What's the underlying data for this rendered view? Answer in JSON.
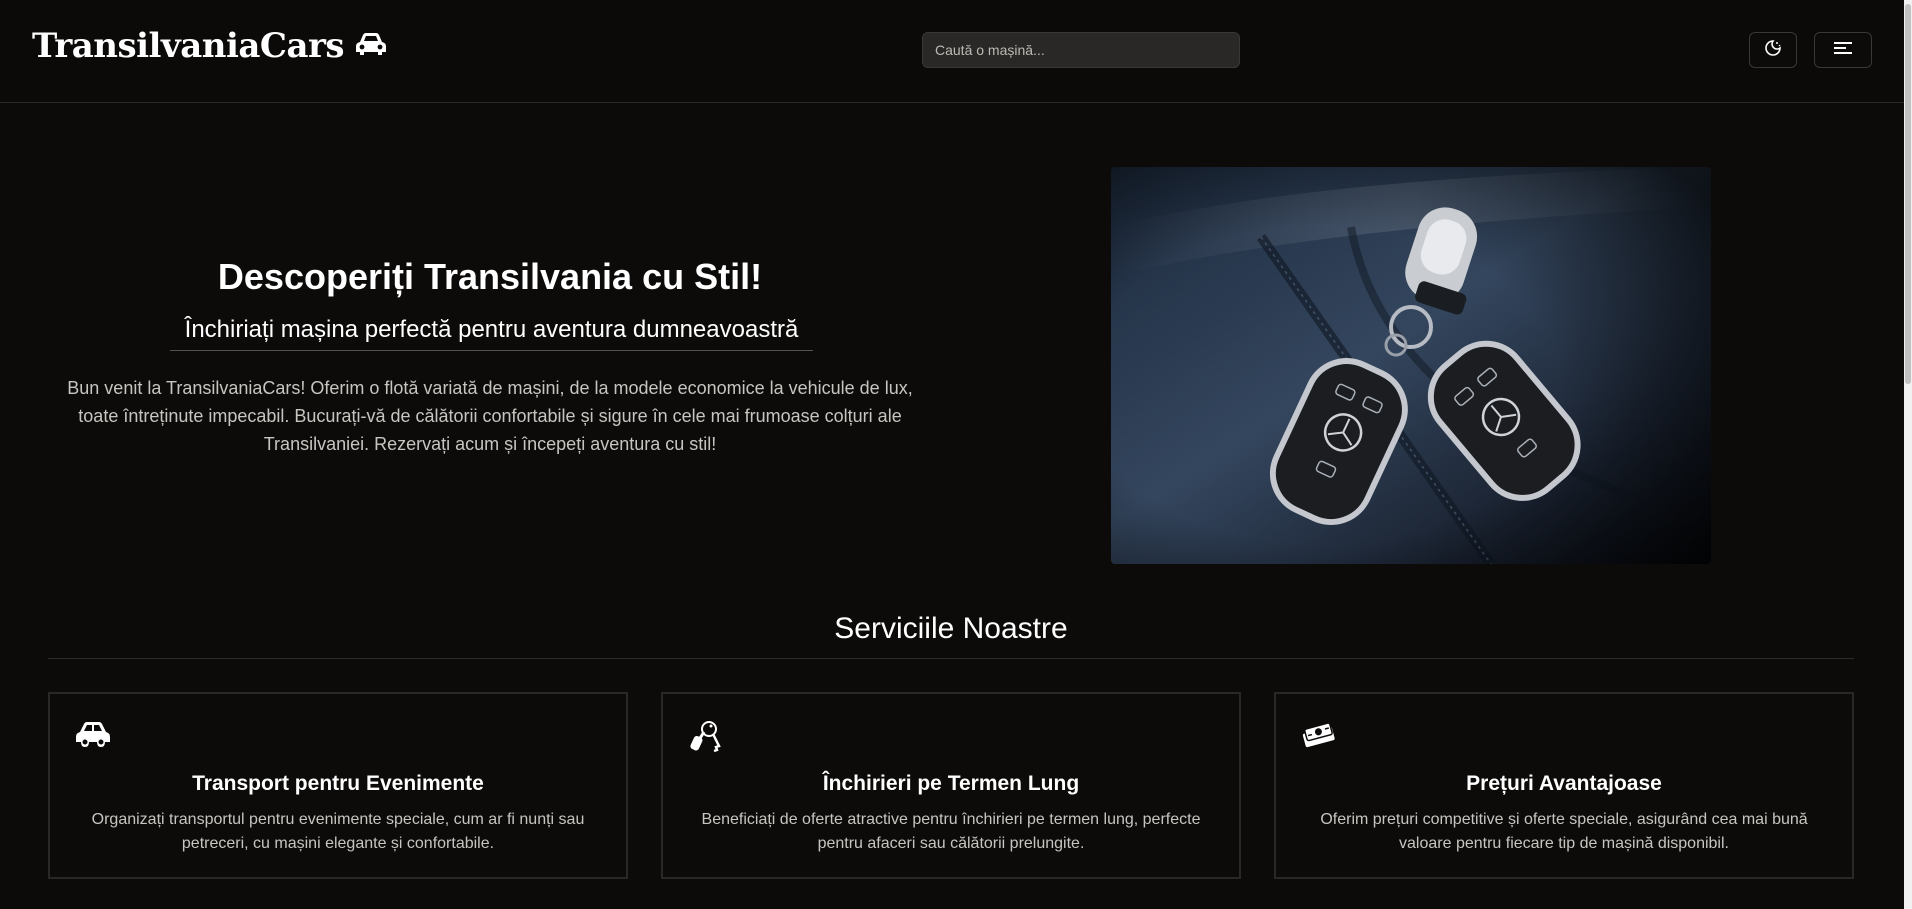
{
  "header": {
    "logo_text": "TransilvaniaCars",
    "logo_icon": "car-icon",
    "search_placeholder": "Caută o mașină...",
    "theme_toggle_icon": "moon-sun-icon",
    "menu_icon": "hamburger-icon"
  },
  "hero": {
    "title": "Descoperiți Transilvania cu Stil!",
    "subtitle": "Închiriați mașina perfectă pentru aventura dumneavoastră",
    "description": "Bun venit la TransilvaniaCars! Oferim o flotă variată de mașini, de la modele economice la vehicule de lux, toate întreținute impecabil. Bucurați-vă de călătorii confortabile și sigure în cele mai frumoase colțuri ale Transilvaniei. Rezervați acum și începeți aventura cu stil!",
    "image": "car-keys-photo"
  },
  "services": {
    "title": "Serviciile Noastre",
    "items": [
      {
        "icon": "car-icon",
        "title": "Transport pentru Evenimente",
        "description": "Organizați transportul pentru evenimente speciale, cum ar fi nunți sau petreceri, cu mașini elegante și confortabile."
      },
      {
        "icon": "keys-icon",
        "title": "Închirieri pe Termen Lung",
        "description": "Beneficiați de oferte atractive pentru închirieri pe termen lung, perfecte pentru afaceri sau călătorii prelungite."
      },
      {
        "icon": "money-icon",
        "title": "Prețuri Avantajoase",
        "description": "Oferim prețuri competitive și oferte speciale, asigurând cea mai bună valoare pentru fiecare tip de mașină disponibil."
      }
    ]
  },
  "colors": {
    "background": "#0c0b0a",
    "text": "#ffffff",
    "muted_text": "#c8c5c1",
    "border": "#2a2826"
  }
}
